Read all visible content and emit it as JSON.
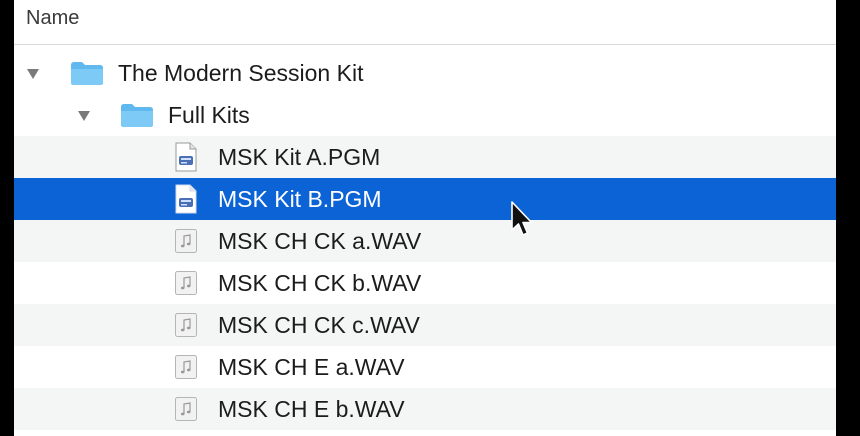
{
  "header": {
    "column_name": "Name"
  },
  "rows": [
    {
      "label": "The Modern Session Kit",
      "kind": "folder",
      "expanded": true
    },
    {
      "label": "Full Kits",
      "kind": "folder",
      "expanded": true
    },
    {
      "label": "MSK Kit A.PGM",
      "kind": "pgm-file"
    },
    {
      "label": "MSK Kit B.PGM",
      "kind": "pgm-file",
      "selected": true
    },
    {
      "label": "MSK CH CK a.WAV",
      "kind": "audio-file"
    },
    {
      "label": "MSK CH CK b.WAV",
      "kind": "audio-file"
    },
    {
      "label": "MSK CH CK c.WAV",
      "kind": "audio-file"
    },
    {
      "label": "MSK CH E a.WAV",
      "kind": "audio-file"
    },
    {
      "label": "MSK CH E b.WAV",
      "kind": "audio-file"
    }
  ],
  "colors": {
    "selection": "#0b63d6",
    "folder": "#5fb8ee",
    "alt_row": "#f4f5f5"
  },
  "icons": {
    "disclosure": "disclosure-triangle-down-icon",
    "folder": "folder-icon",
    "pgm": "document-pgm-icon",
    "audio": "audio-file-icon",
    "cursor": "mouse-pointer-icon"
  }
}
